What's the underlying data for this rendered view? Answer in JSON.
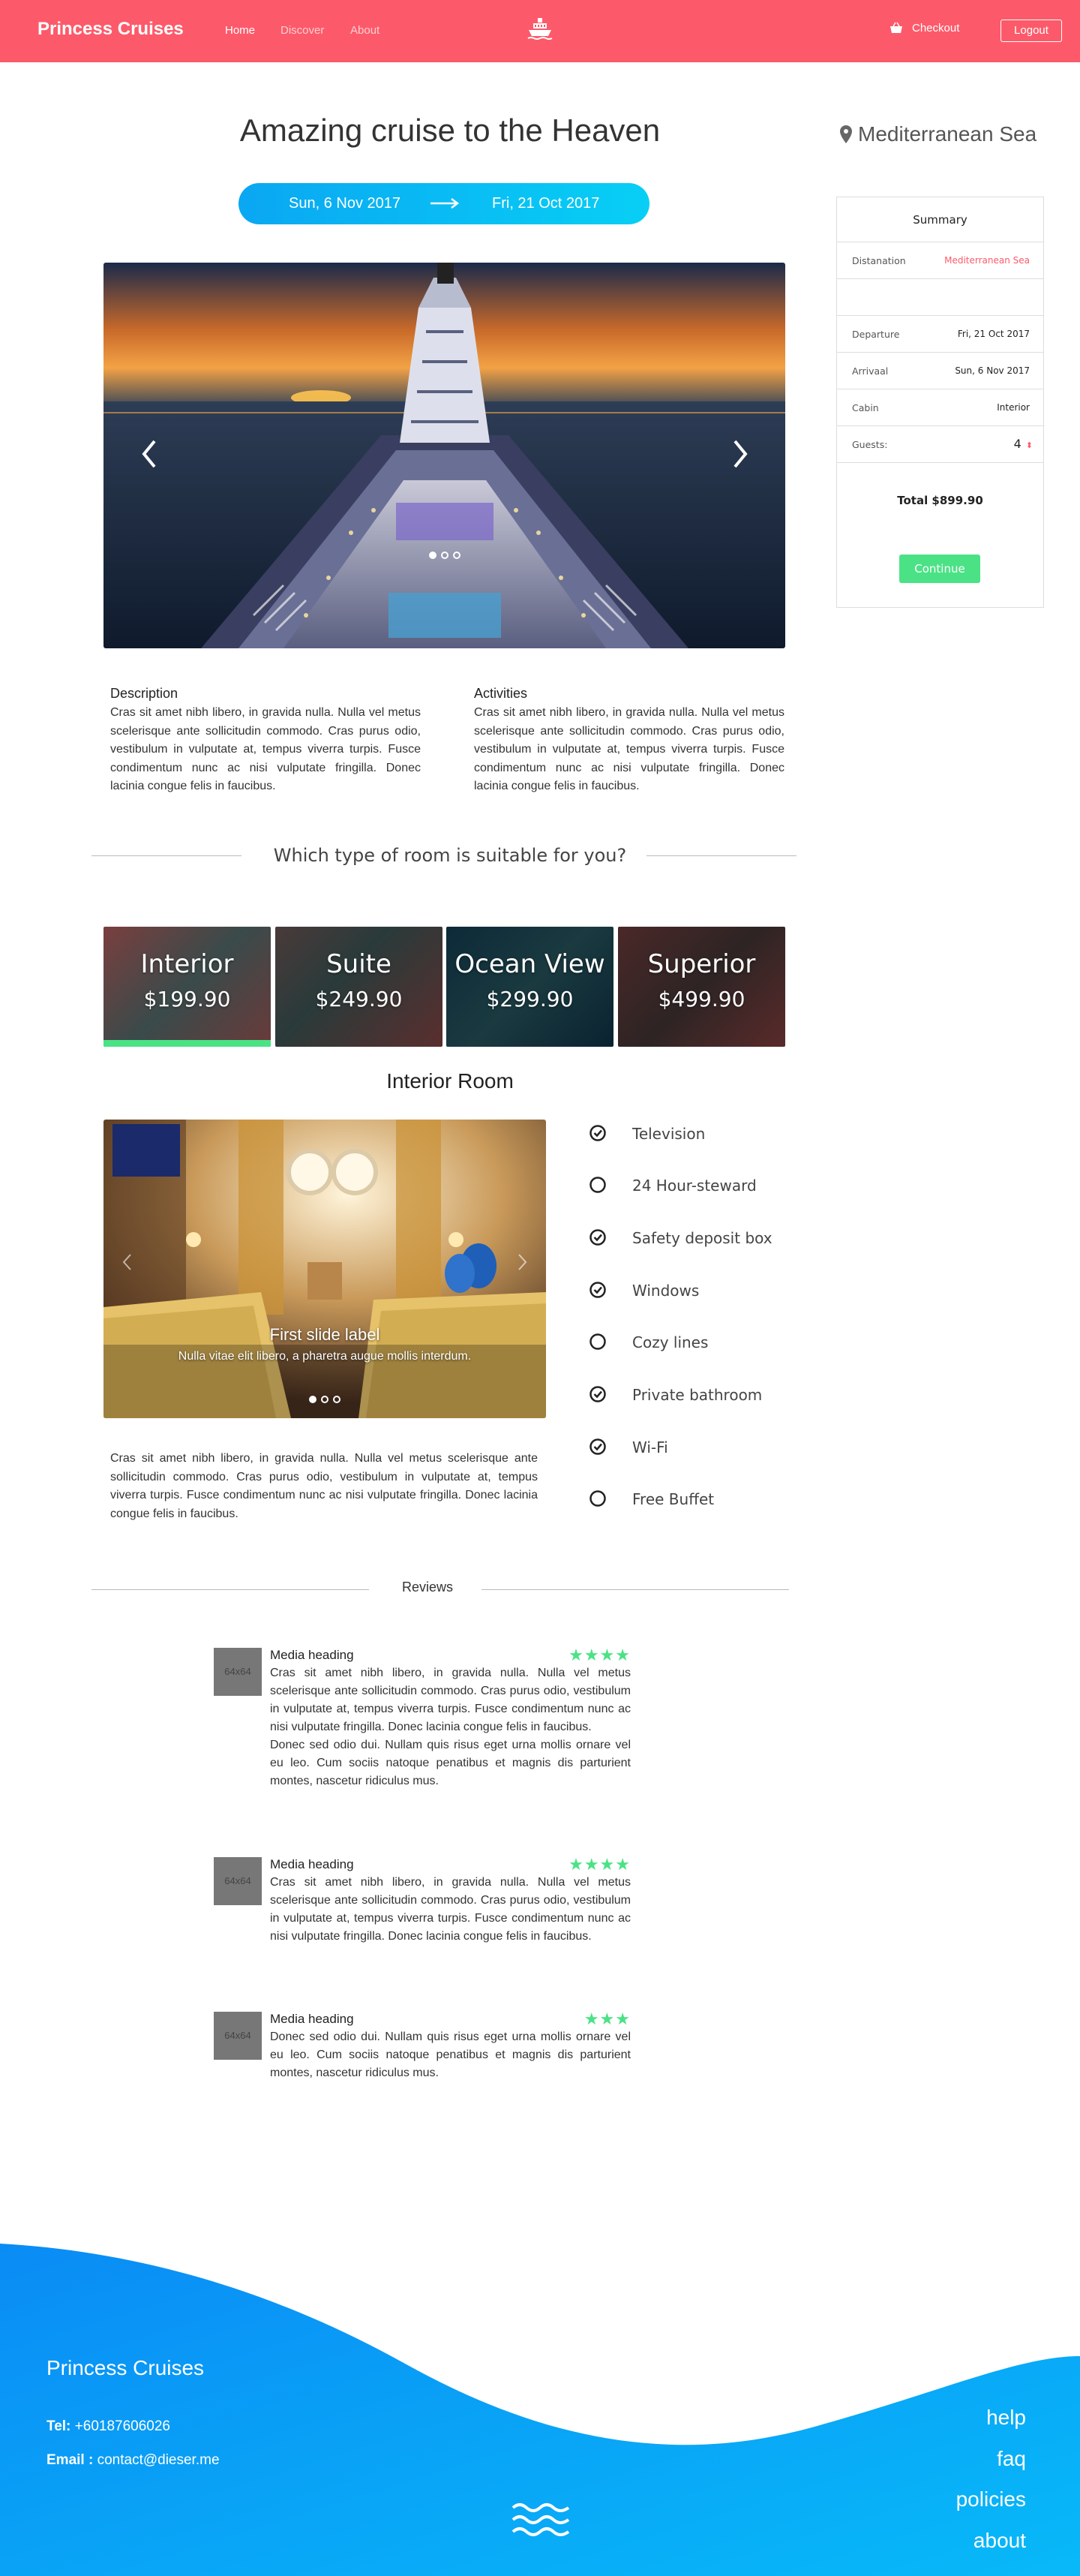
{
  "nav": {
    "brand": "Princess Cruises",
    "links": [
      "Home",
      "Discover",
      "About"
    ],
    "checkout": "Checkout",
    "logout": "Logout"
  },
  "hero": {
    "title": "Amazing cruise to the Heaven",
    "date_from": "Sun, 6 Nov 2017",
    "date_to": "Fri, 21 Oct 2017"
  },
  "location": "Mediterranean Sea",
  "summary": {
    "title": "Summary",
    "rows": [
      {
        "label": "Distanation",
        "value": "Mediterranean Sea"
      },
      {
        "label": "Departure",
        "value": "Fri, 21 Oct 2017"
      },
      {
        "label": "Arrivaal",
        "value": "Sun, 6 Nov 2017"
      },
      {
        "label": "Cabin",
        "value": "Interior"
      },
      {
        "label": "Guests:",
        "value": "4"
      }
    ],
    "total": "Total $899.90",
    "continue": "Continue"
  },
  "description": {
    "heading": "Description",
    "text": "Cras sit amet nibh libero, in gravida nulla. Nulla vel metus scelerisque ante sollicitudin commodo. Cras purus odio, vestibulum in vulputate at, tempus viverra turpis. Fusce condimentum nunc ac nisi vulputate fringilla. Donec lacinia congue felis in faucibus."
  },
  "activities": {
    "heading": "Activities",
    "text": "Cras sit amet nibh libero, in gravida nulla. Nulla vel metus scelerisque ante sollicitudin commodo. Cras purus odio, vestibulum in vulputate at, tempus viverra turpis. Fusce condimentum nunc ac nisi vulputate fringilla. Donec lacinia congue felis in faucibus."
  },
  "rooms": {
    "question": "Which type of room is suitable for you?",
    "cards": [
      {
        "name": "Interior",
        "price": "$199.90"
      },
      {
        "name": "Suite",
        "price": "$249.90"
      },
      {
        "name": "Ocean View",
        "price": "$299.90"
      },
      {
        "name": "Superior",
        "price": "$499.90"
      }
    ],
    "selected": "Interior",
    "detail_title": "Interior Room",
    "slide_label": "First slide label",
    "slide_caption": "Nulla vitae elit libero, a pharetra augue mollis interdum.",
    "text": "Cras sit amet nibh libero, in gravida nulla. Nulla vel metus scelerisque ante sollicitudin commodo. Cras purus odio, vestibulum in vulputate at, tempus viverra turpis. Fusce condimentum nunc ac nisi vulputate fringilla. Donec lacinia congue felis in faucibus.",
    "amenities": [
      {
        "label": "Television",
        "included": true
      },
      {
        "label": "24 Hour-steward",
        "included": false
      },
      {
        "label": "Safety deposit box",
        "included": true
      },
      {
        "label": "Windows",
        "included": true
      },
      {
        "label": "Cozy lines",
        "included": false
      },
      {
        "label": "Private bathroom",
        "included": true
      },
      {
        "label": "Wi-Fi",
        "included": true
      },
      {
        "label": "Free Buffet",
        "included": false
      }
    ]
  },
  "reviews": {
    "heading": "Reviews",
    "items": [
      {
        "thumb": "64x64",
        "heading": "Media heading",
        "stars": 4,
        "text": "Cras sit amet nibh libero, in gravida nulla. Nulla vel metus scelerisque ante sollicitudin commodo. Cras purus odio, vestibulum in vulputate at, tempus viverra turpis. Fusce condimentum nunc ac nisi vulputate fringilla. Donec lacinia congue felis in faucibus.",
        "text2": "Donec sed odio dui. Nullam quis risus eget urna mollis ornare vel eu leo. Cum sociis natoque penatibus et magnis dis parturient montes, nascetur ridiculus mus."
      },
      {
        "thumb": "64x64",
        "heading": "Media heading",
        "stars": 4,
        "text": "Cras sit amet nibh libero, in gravida nulla. Nulla vel metus scelerisque ante sollicitudin commodo. Cras purus odio, vestibulum in vulputate at, tempus viverra turpis. Fusce condimentum nunc ac nisi vulputate fringilla. Donec lacinia congue felis in faucibus."
      },
      {
        "thumb": "64x64",
        "heading": "Media heading",
        "stars": 3,
        "text": "Donec sed odio dui. Nullam quis risus eget urna mollis ornare vel eu leo. Cum sociis natoque penatibus et magnis dis parturient montes, nascetur ridiculus mus."
      }
    ]
  },
  "footer": {
    "brand": "Princess Cruises",
    "tel_label": "Tel:",
    "tel": "+60187606026",
    "email_label": "Email :",
    "email": "contact@dieser.me",
    "links": [
      "help",
      "faq",
      "policies",
      "about"
    ]
  },
  "colors": {
    "brand_red": "#fc5a6a",
    "accent_green": "#4be286",
    "accent_blue": "#0aa7f2"
  }
}
